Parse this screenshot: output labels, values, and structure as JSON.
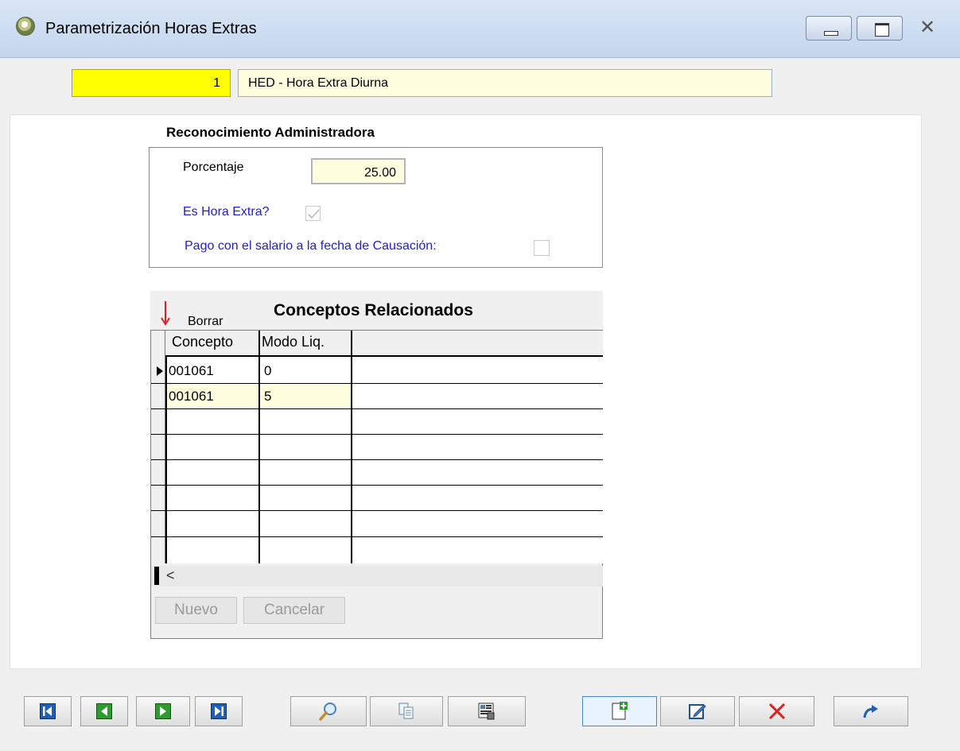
{
  "window": {
    "title": "Parametrización  Horas Extras"
  },
  "header": {
    "code": "1",
    "name": "HED - Hora Extra Diurna"
  },
  "reconocimiento": {
    "title": "Reconocimiento Administradora",
    "porcentaje_label": "Porcentaje",
    "porcentaje_value": "25.00",
    "es_hora_extra_label": "Es Hora Extra?",
    "es_hora_extra_checked": true,
    "pago_label": "Pago con el salario a la fecha de Causación:",
    "pago_checked": false
  },
  "grid": {
    "title": "Conceptos Relacionados",
    "borrar_label": "Borrar",
    "columns": [
      "Concepto",
      "Modo Liq."
    ],
    "rows": [
      {
        "concepto": "001061",
        "modo": "0"
      },
      {
        "concepto": "001061",
        "modo": "5"
      }
    ],
    "scroll_left_glyph": "<",
    "nuevo_label": "Nuevo",
    "cancelar_label": "Cancelar"
  },
  "toolbar": {
    "icons": [
      "first-record-icon",
      "previous-record-icon",
      "next-record-icon",
      "last-record-icon",
      "search-icon",
      "copy-icon",
      "report-icon",
      "new-document-icon",
      "edit-icon",
      "delete-icon",
      "undo-icon"
    ]
  },
  "colors": {
    "accent_yellow": "#ffff00",
    "field_bg": "#ffffe0",
    "label_blue": "#2020d0",
    "delete_red": "#e02020"
  }
}
